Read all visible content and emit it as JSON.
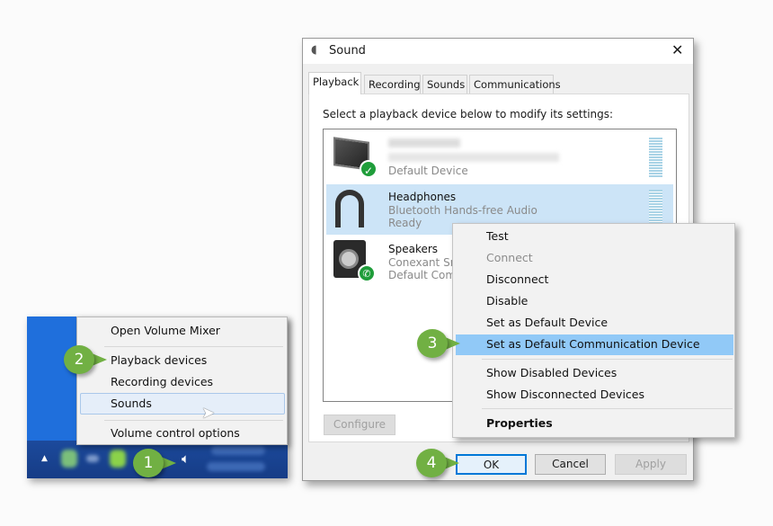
{
  "tray_menu": {
    "items": [
      {
        "label": "Open Volume Mixer"
      },
      {
        "label": "Playback devices"
      },
      {
        "label": "Recording devices"
      },
      {
        "label": "Sounds",
        "highlighted": true
      },
      {
        "label": "Volume control options"
      }
    ]
  },
  "taskbar": {
    "icons": [
      "show-hidden-icons-arrow",
      "speaker-icon"
    ]
  },
  "dialog": {
    "title": "Sound",
    "close": "✕",
    "tabs": [
      "Playback",
      "Recording",
      "Sounds",
      "Communications"
    ],
    "active_tab": "Playback",
    "instruction": "Select a playback device below to modify its settings:",
    "devices": [
      {
        "name": "",
        "subtitle": "",
        "status": "Default Device",
        "badge": "check"
      },
      {
        "name": "Headphones",
        "subtitle": "Bluetooth Hands-free Audio",
        "status": "Ready",
        "selected": true
      },
      {
        "name": "Speakers",
        "subtitle": "Conexant Sm",
        "status": "Default Comm",
        "badge": "phone"
      }
    ],
    "configure": "Configure",
    "ok": "OK",
    "cancel": "Cancel",
    "apply": "Apply"
  },
  "context_menu": {
    "items": [
      {
        "label": "Test"
      },
      {
        "label": "Connect",
        "disabled": true
      },
      {
        "label": "Disconnect"
      },
      {
        "label": "Disable"
      },
      {
        "label": "Set as Default Device"
      },
      {
        "label": "Set as Default Communication Device",
        "highlighted": true
      },
      {
        "label": "Show Disabled Devices"
      },
      {
        "label": "Show Disconnected Devices"
      },
      {
        "label": "Properties",
        "bold": true
      }
    ]
  },
  "callouts": [
    "1",
    "2",
    "3",
    "4"
  ],
  "colors": {
    "callout": "#71b043",
    "selection": "#cce4f7",
    "menu_highlight": "#91c9f7",
    "desktop": "#1f6fdc"
  }
}
